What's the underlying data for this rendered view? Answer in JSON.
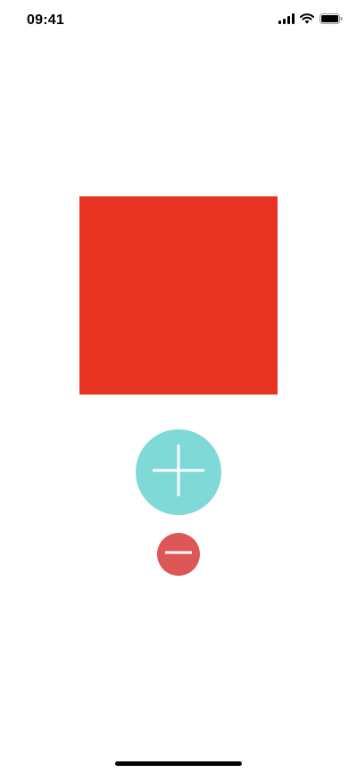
{
  "status_bar": {
    "time": "09:41",
    "icons": [
      "cellular-signal-icon",
      "wifi-icon",
      "battery-icon"
    ]
  },
  "canvas": {
    "square_color": "#e83222"
  },
  "controls": {
    "plus_button": {
      "icon": "plus-icon",
      "color": "#7fd9d7"
    },
    "minus_button": {
      "icon": "minus-icon",
      "color": "#dc5755"
    }
  }
}
